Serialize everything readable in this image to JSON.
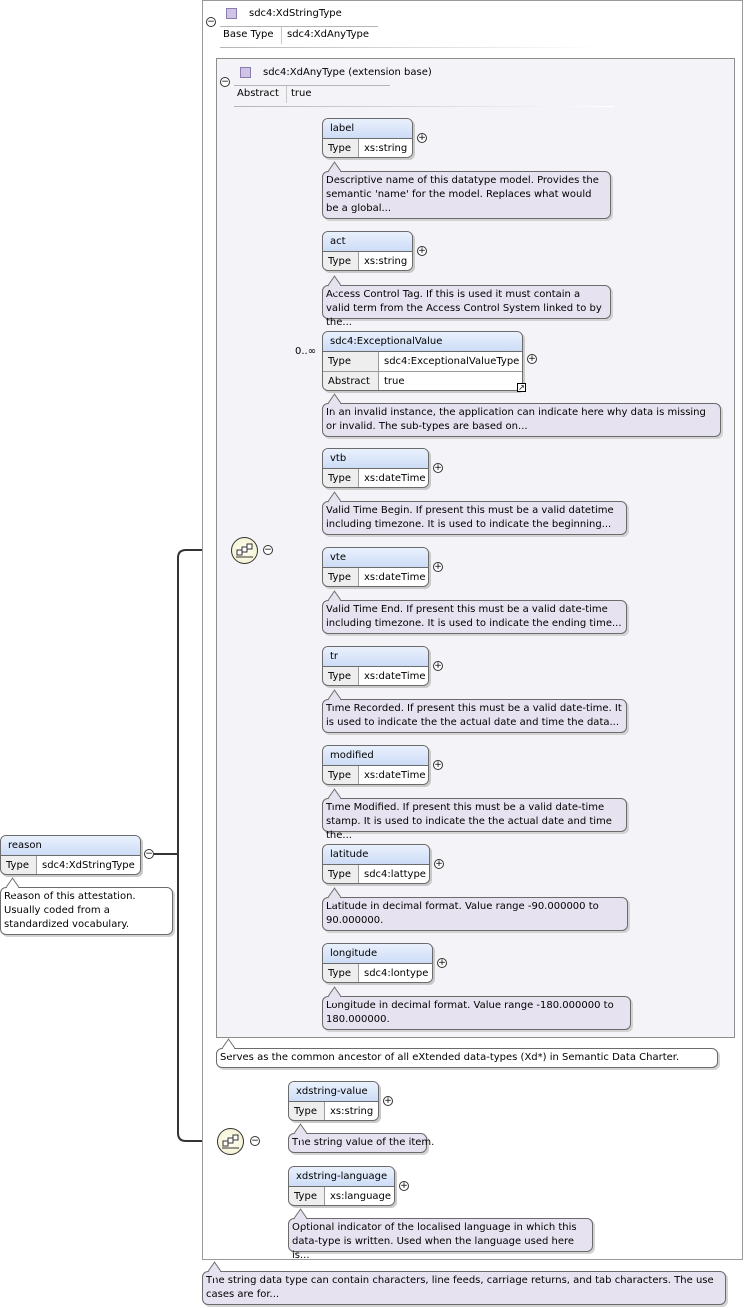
{
  "xd_string_type": {
    "name": "sdc4:XdStringType",
    "props": [
      {
        "key": "Base Type",
        "value": "sdc4:XdAnyType"
      }
    ],
    "doc": "The string data type can contain characters, line feeds, carriage returns, and tab characters. The use cases are for..."
  },
  "xd_any_type": {
    "name": "sdc4:XdAnyType (extension base)",
    "props": [
      {
        "key": "Abstract",
        "value": "true"
      }
    ],
    "doc": "Serves as the common ancestor of all eXtended data-types (Xd*) in Semantic Data Charter."
  },
  "reason": {
    "name": "reason",
    "type_key": "Type",
    "type_value": "sdc4:XdStringType",
    "doc": "Reason of this attestation. Usually coded from a standardized vocabulary."
  },
  "ext_elements": [
    {
      "name": "label",
      "type_key": "Type",
      "type_value": "xs:string",
      "doc": "Descriptive name of this datatype model. Provides the semantic 'name' for the model. Replaces what would be a global..."
    },
    {
      "name": "act",
      "type_key": "Type",
      "type_value": "xs:string",
      "doc": "Access Control Tag. If this is used it must contain a valid term from the Access Control System linked to by the..."
    },
    {
      "name": "sdc4:ExceptionalValue",
      "type_key": "Type",
      "type_value": "sdc4:ExceptionalValueType",
      "abstract_key": "Abstract",
      "abstract_value": "true",
      "occurrence": "0..∞",
      "doc": "In an invalid instance, the application can indicate here why data is missing or invalid. The sub-types are based on..."
    },
    {
      "name": "vtb",
      "type_key": "Type",
      "type_value": "xs:dateTime",
      "doc": "Valid Time Begin. If present this must be a valid datetime including timezone. It is used to indicate the beginning..."
    },
    {
      "name": "vte",
      "type_key": "Type",
      "type_value": "xs:dateTime",
      "doc": "Valid Time End. If present this must be a valid date-time including timezone. It is used to indicate the ending time..."
    },
    {
      "name": "tr",
      "type_key": "Type",
      "type_value": "xs:dateTime",
      "doc": "Time Recorded. If present this must be a valid date-time. It is used to indicate the the actual date and time the data..."
    },
    {
      "name": "modified",
      "type_key": "Type",
      "type_value": "xs:dateTime",
      "doc": "Time Modified. If present this must be a valid date-time stamp. It is used to indicate the the actual date and time the..."
    },
    {
      "name": "latitude",
      "type_key": "Type",
      "type_value": "sdc4:lattype",
      "doc": "Latitude in decimal format. Value range -90.000000 to 90.000000."
    },
    {
      "name": "longitude",
      "type_key": "Type",
      "type_value": "sdc4:lontype",
      "doc": "Longitude in decimal format. Value range -180.000000 to 180.000000."
    }
  ],
  "string_elements": [
    {
      "name": "xdstring-value",
      "type_key": "Type",
      "type_value": "xs:string",
      "doc": "The string value of the item."
    },
    {
      "name": "xdstring-language",
      "type_key": "Type",
      "type_value": "xs:language",
      "doc": "Optional indicator of the localised language in which this data-type is written. Used when the language used here is..."
    }
  ],
  "icons": {
    "collapse": "minus-circle-icon",
    "expand": "plus-circle-icon",
    "sequence": "sequence-compositor-icon",
    "ref": "reference-arrow-icon",
    "complex_type": "complex-type-icon"
  },
  "colors": {
    "element_header": "#cddcf6",
    "note_bg": "#e6e2ef",
    "frame_bg": "#f4f3f8",
    "type_icon": "#cfc4e6"
  }
}
